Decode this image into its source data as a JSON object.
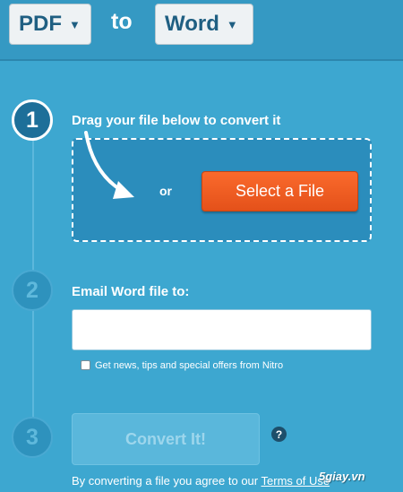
{
  "header": {
    "from_format": "PDF",
    "to_text": "to",
    "to_format": "Word"
  },
  "steps": [
    {
      "number": "1",
      "label": "Drag your file below to convert it"
    },
    {
      "number": "2",
      "label": "Email Word file to:"
    },
    {
      "number": "3"
    }
  ],
  "dropzone": {
    "or_text": "or",
    "select_button": "Select a File"
  },
  "email": {
    "value": "",
    "placeholder": ""
  },
  "newsletter": {
    "label": "Get news, tips and special offers from Nitro",
    "checked": false
  },
  "convert": {
    "button_label": "Convert It!",
    "help_glyph": "?"
  },
  "terms": {
    "prefix": "By converting a file you agree to our",
    "link": "Terms of Use"
  },
  "watermark": "5giay.vn",
  "colors": {
    "background": "#3da7d0",
    "accent_orange": "#f05a22",
    "step_active": "#1d6f99"
  }
}
